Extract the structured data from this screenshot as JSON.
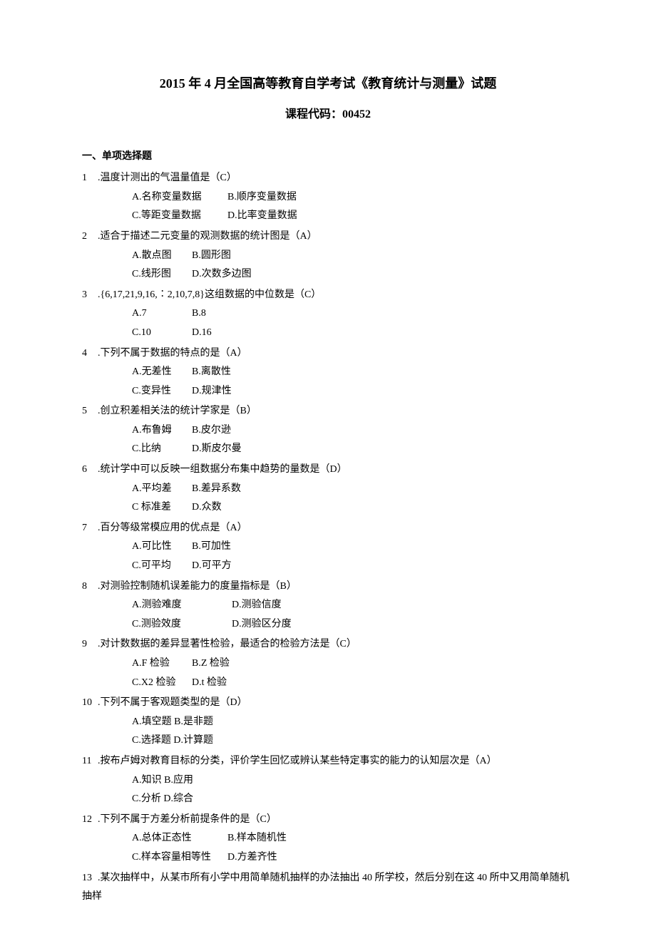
{
  "title": "2015 年 4 月全国高等教育自学考试《教育统计与测量》试题",
  "subtitle": "课程代码：00452",
  "section1": "一、单项选择题",
  "questions": [
    {
      "num": "1",
      "stem": ".温度计测出的气温量值是（C）",
      "optA": "A.名称变量数据",
      "optB": "B.顺序变量数据",
      "optC": "C.等距变量数据",
      "optD": "D.比率变量数据",
      "wA": 134,
      "wB": 134
    },
    {
      "num": "2",
      "stem": ".适合于描述二元变量的观测数据的统计图是（A）",
      "optA": "A.散点图",
      "optB": "B.圆形图",
      "optC": "C.线形图",
      "optD": "D.次数多边图",
      "wA": 84,
      "wB": 84
    },
    {
      "num": "3",
      "stem": ".{6,17,21,9,16,∶2,10,7,8}这组数据的中位数是（C）",
      "optA": "A.7",
      "optB": "B.8",
      "optC": "C.10",
      "optD": "D.16",
      "wA": 84,
      "wB": 84
    },
    {
      "num": "4",
      "stem": ".下列不属于数据的特点的是（A）",
      "optA": "A.无差性",
      "optB": "B.离散性",
      "optC": "C.变异性",
      "optD": "D.规津性",
      "wA": 84,
      "wB": 84
    },
    {
      "num": "5",
      "stem": ".创立积差相关法的统计学家是（B）",
      "optA": "A.布鲁姆",
      "optB": "B.皮尔逊",
      "optC": "C.比纳",
      "optD": "D.斯皮尔曼",
      "wA": 84,
      "wB": 84
    },
    {
      "num": "6",
      "stem": ".统计学中可以反映一组数据分布集中趋势的量数是（D）",
      "optA": "A.平均差",
      "optB": "B.差异系数",
      "optC": "C 标准差",
      "optD": "D.众数",
      "wA": 84,
      "wB": 84
    },
    {
      "num": "7",
      "stem": ".百分等级常模应用的优点是（A）",
      "optA": "A.可比性",
      "optB": "B.可加性",
      "optC": "C.可平均",
      "optD": "D.可平方",
      "wA": 84,
      "wB": 84
    },
    {
      "num": "8",
      "stem": ".对测验控制随机误差能力的度量指标是（B）",
      "optA": "A.测验难度",
      "optB": "D.测验信度",
      "optC": "C.测验效度",
      "optD": "D.测验区分度",
      "wA": 140,
      "wB": 140
    },
    {
      "num": "9",
      "stem": ".对计数数据的差异显著性检验，最适合的检验方法是（C）",
      "optA": "A.F 检验",
      "optB": "B.Z 检验",
      "optC": "C.X2 检验",
      "optD": "D.t 检验",
      "wA": 84,
      "wB": 84
    },
    {
      "num": "10",
      "stem": ".下列不属于客观题类型的是（D）",
      "optA": "A.填空题 B.是非题",
      "optB": "",
      "optC": "C.选择题 D.计算题",
      "optD": "",
      "wA": 200,
      "wB": 0
    },
    {
      "num": "11",
      "stem": ".按布卢姆对教育目标的分类，评价学生回忆或辨认某些特定事实的能力的认知层次是（A）",
      "optA": "A.知识 B.应用",
      "optB": "",
      "optC": "C.分析 D.综合",
      "optD": "",
      "wA": 200,
      "wB": 0
    },
    {
      "num": "12",
      "stem": ".下列不属于方差分析前提条件的是（C）",
      "optA": "A.总体正态性",
      "optB": "B.样本随机性",
      "optC": "C.样本容量相等性",
      "optD": "D.方差齐性",
      "wA": 134,
      "wB": 134
    },
    {
      "num": "13",
      "stem": ".某次抽样中，从某市所有小学中用简单随机抽样的办法抽出 40 所学校，然后分别在这 40 所中又用简单随机抽样",
      "optA": "",
      "optB": "",
      "optC": "",
      "optD": "",
      "wA": 0,
      "wB": 0
    }
  ]
}
